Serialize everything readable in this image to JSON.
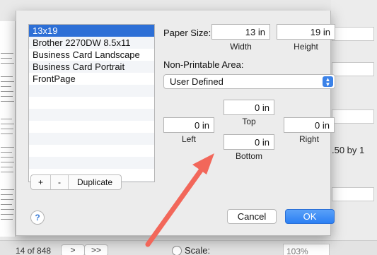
{
  "background": {
    "scale_partial_text": ".50 by 1",
    "page_counter": "14 of 848",
    "nav_next_label": ">",
    "nav_last_label": ">>",
    "scale_label": "Scale:",
    "scale_value": "103%"
  },
  "paper_list": {
    "items": [
      "13x19",
      "Brother 2270DW 8.5x11",
      "Business Card Landscape",
      "Business Card Portrait",
      "FrontPage"
    ],
    "selected_index": 0,
    "add_label": "+",
    "remove_label": "-",
    "duplicate_label": "Duplicate"
  },
  "paper_size": {
    "label": "Paper Size:",
    "width_value": "13 in",
    "width_label": "Width",
    "height_value": "19 in",
    "height_label": "Height"
  },
  "non_printable": {
    "label": "Non-Printable Area:",
    "selected_option": "User Defined",
    "top_value": "0 in",
    "top_label": "Top",
    "left_value": "0 in",
    "left_label": "Left",
    "right_value": "0 in",
    "right_label": "Right",
    "bottom_value": "0 in",
    "bottom_label": "Bottom"
  },
  "footer": {
    "help_label": "?",
    "cancel_label": "Cancel",
    "ok_label": "OK"
  },
  "colors": {
    "accent": "#2d6fd6",
    "annotation_arrow": "#f2675a"
  },
  "icons": {
    "select_arrows": "up-down-chevron-icon",
    "help": "question-icon"
  }
}
